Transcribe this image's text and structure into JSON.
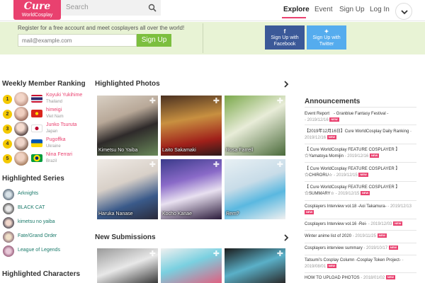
{
  "header": {
    "logo_title": "Cure",
    "logo_subtitle": "WorldCosplay",
    "search_placeholder": "Search",
    "nav": [
      "Explore",
      "Event",
      "Sign Up",
      "Log In"
    ]
  },
  "banner": {
    "text": "Register for a free account and meet cosplayers all over the world!",
    "email_placeholder": "mail@example.com",
    "signup_label": "Sign Up",
    "facebook": [
      "Sign Up with",
      "Facebook"
    ],
    "twitter": [
      "Sign Up with",
      "Twitter"
    ]
  },
  "ranking": {
    "title": "Weekly Member Ranking",
    "items": [
      {
        "rank": "1",
        "name": "Koyuki Yukihime",
        "country": "Thailand"
      },
      {
        "rank": "2",
        "name": "himeigi",
        "country": "Viet Nam"
      },
      {
        "rank": "3",
        "name": "Junko Tsuruta",
        "country": "Japan"
      },
      {
        "rank": "4",
        "name": "Pugoffka",
        "country": "Ukraine"
      },
      {
        "rank": "5",
        "name": "Nina Ferrari",
        "country": "Brazil"
      }
    ]
  },
  "series": {
    "title": "Highlighted Series",
    "items": [
      "Arknights",
      "BLACK CAT",
      "kimetsu no yaiba",
      "Fate/Grand Order",
      "League of Legends"
    ]
  },
  "characters_title": "Highlighted Characters",
  "photos": {
    "title": "Highlighted Photos",
    "items": [
      {
        "caption": "Kimetsu No Yaiba"
      },
      {
        "caption": "Laito Sakamaki"
      },
      {
        "caption": "Rosa Farrell"
      },
      {
        "caption": "Haruka Nanase"
      },
      {
        "caption": "Kocho Kanae"
      },
      {
        "caption": "Rem?"
      }
    ]
  },
  "submissions_title": "New Submissions",
  "announcements": {
    "title": "Announcements",
    "new_label": "NEW",
    "items": [
      {
        "title": "Event Report　- Granblue Fantasy Festival -",
        "date": "- 2019/12/16"
      },
      {
        "title": "【2019年12月16日】Cure WorldCosplay Daily Ranking",
        "date": "- 2019/12/16"
      },
      {
        "title": "【 Cure WorldCosplay FEATURE COSPLAYER 】☆Yamatoya Momijin",
        "date": "- 2019/12/16"
      },
      {
        "title": "【 Cure WorldCosplay FEATURE COSPLAYER 】☆CHIRORU☆",
        "date": "- 2019/12/15"
      },
      {
        "title": "【 Cure WorldCosplay FEATURE COSPLAYER 】☆SUMMARY☆",
        "date": "- 2019/12/15"
      },
      {
        "title": "Cosplayers Interview vol.18 -Aoi Takamura-",
        "date": "- 2019/12/13"
      },
      {
        "title": "Cosplayers Interview vol.16 -Rei-",
        "date": "- 2019/12/03"
      },
      {
        "title": "Winter anime list of 2020",
        "date": "- 2019/11/25"
      },
      {
        "title": "Cosplayers interview summary",
        "date": "- 2019/10/17"
      },
      {
        "title": "Tatsumi's Cosplay Column -Cosplay Token Project-",
        "date": "- 2019/08/01"
      },
      {
        "title": "HOW TO UPLOAD PHOTOS",
        "date": "- 2018/01/02"
      }
    ]
  },
  "colors": {
    "brand": "#e9416f",
    "accent_green": "#7cbf3f",
    "banner_bg": "#e8f3d5",
    "facebook": "#3b5998",
    "twitter": "#55acee",
    "series_text": "#1a7a6a"
  }
}
